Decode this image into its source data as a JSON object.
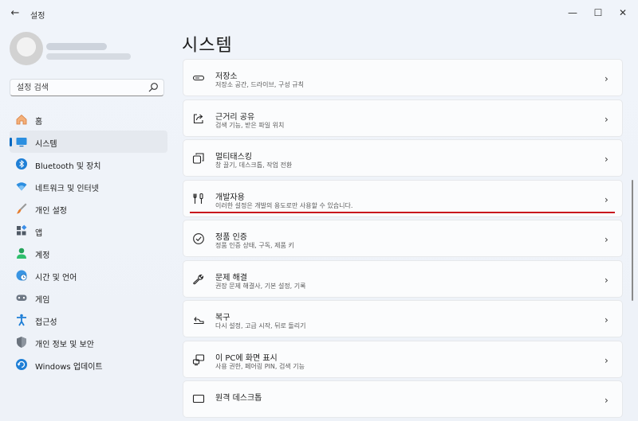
{
  "window": {
    "title": "설정",
    "back": "←",
    "minimize": "—",
    "maximize": "☐",
    "close": "✕"
  },
  "search": {
    "placeholder": "설정 검색"
  },
  "nav": {
    "items": [
      {
        "label": "홈",
        "icon": "home-icon"
      },
      {
        "label": "시스템",
        "icon": "system-icon",
        "active": true
      },
      {
        "label": "Bluetooth 및 장치",
        "icon": "bluetooth-icon"
      },
      {
        "label": "네트워크 및 인터넷",
        "icon": "wifi-icon"
      },
      {
        "label": "개인 설정",
        "icon": "brush-icon"
      },
      {
        "label": "앱",
        "icon": "apps-icon"
      },
      {
        "label": "계정",
        "icon": "account-icon"
      },
      {
        "label": "시간 및 언어",
        "icon": "globe-clock-icon"
      },
      {
        "label": "게임",
        "icon": "gamepad-icon"
      },
      {
        "label": "접근성",
        "icon": "accessibility-icon"
      },
      {
        "label": "개인 정보 및 보안",
        "icon": "shield-icon"
      },
      {
        "label": "Windows 업데이트",
        "icon": "update-icon"
      }
    ]
  },
  "main": {
    "title": "시스템",
    "cards": [
      {
        "title": "저장소",
        "desc": "저장소 공간, 드라이브, 구성 규칙",
        "icon": "storage-icon"
      },
      {
        "title": "근거리 공유",
        "desc": "검색 기능, 받은 파일 위치",
        "icon": "share-icon"
      },
      {
        "title": "멀티태스킹",
        "desc": "창 끌기, 데스크톱, 작업 전환",
        "icon": "multitasking-icon"
      },
      {
        "title": "개발자용",
        "desc": "이러한 설정은 개발의 용도로만 사용할 수 있습니다.",
        "icon": "developer-tools-icon",
        "highlighted": true
      },
      {
        "title": "정품 인증",
        "desc": "정품 인증 상태, 구독, 제품 키",
        "icon": "activation-check-icon"
      },
      {
        "title": "문제 해결",
        "desc": "권장 문제 해결사, 기본 설정, 기록",
        "icon": "wrench-icon"
      },
      {
        "title": "복구",
        "desc": "다시 설정, 고급 시작, 뒤로 돌리기",
        "icon": "recovery-icon"
      },
      {
        "title": "이 PC에 화면 표시",
        "desc": "사용 권한, 페어링 PIN, 검색 기능",
        "icon": "project-icon"
      },
      {
        "title": "원격 데스크톱",
        "desc": "",
        "icon": "remote-desktop-icon"
      }
    ],
    "chevron": "›"
  },
  "colors": {
    "accent": "#0067c0",
    "highlight": "#c8161d"
  }
}
